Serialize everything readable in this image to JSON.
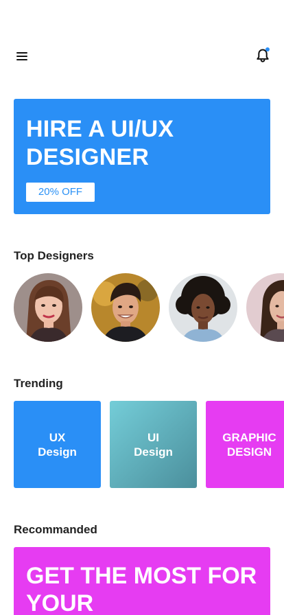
{
  "colors": {
    "hero_bg": "#2a8ff6",
    "badge_text": "#2b91f5",
    "bell_dot": "#2a8ff6",
    "ux_card": "#2a8ff6",
    "ui_card_from": "#74cdd8",
    "ui_card_to": "#4b8f9c",
    "graphic_card": "#e63cf2",
    "promo_bg": "#e63cf2"
  },
  "header": {
    "menu_icon": "hamburger-icon",
    "notification_icon": "bell-icon",
    "has_unread": true
  },
  "hero": {
    "title": "HIRE A UI/UX DESIGNER",
    "badge": "20% OFF"
  },
  "top_designers": {
    "heading": "Top Designers"
  },
  "trending": {
    "heading": "Trending",
    "cards": [
      {
        "line1": "UX",
        "line2": "Design"
      },
      {
        "line1": "UI",
        "line2": "Design"
      },
      {
        "line1": "GRAPHIC",
        "line2": "DESIGN"
      }
    ]
  },
  "recommended": {
    "heading": "Recommanded",
    "promo_title": "GET THE MOST FOR YOUR"
  }
}
